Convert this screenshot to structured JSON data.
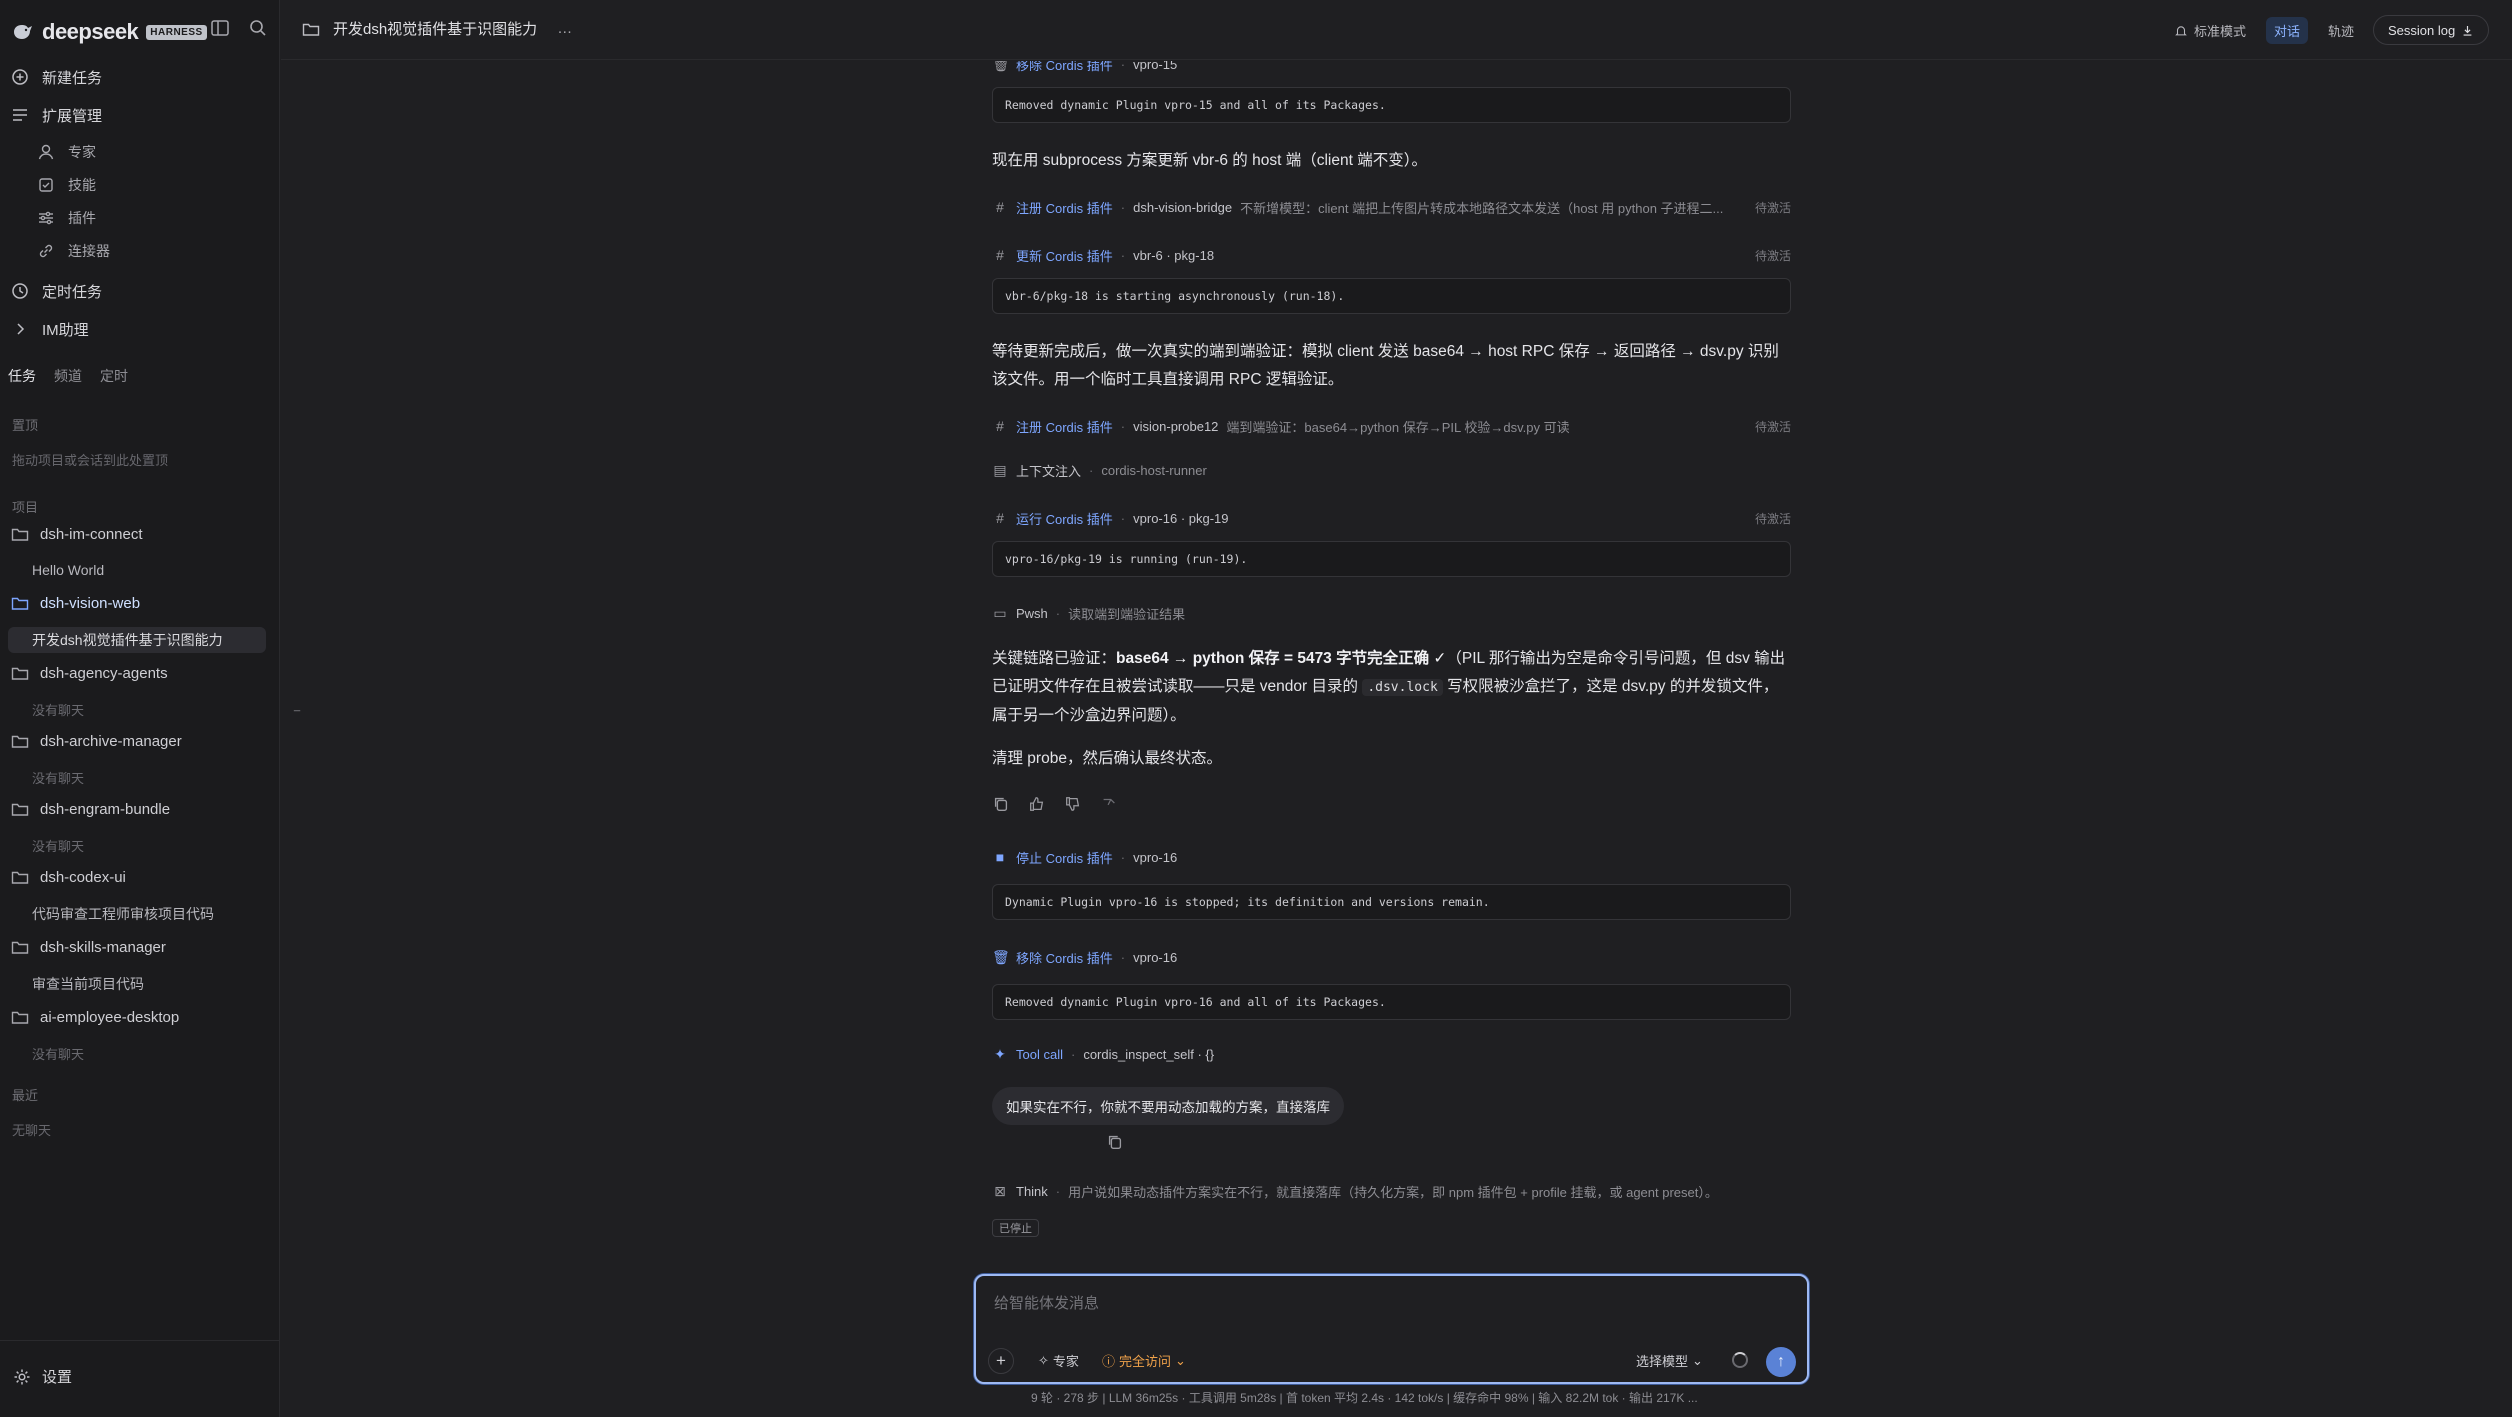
{
  "app": {
    "name": "deepseek",
    "badge": "HARNESS"
  },
  "sidebar": {
    "new_task": "新建任务",
    "extensions": "扩展管理",
    "ext_items": [
      "专家",
      "技能",
      "插件",
      "连接器"
    ],
    "scheduled": "定时任务",
    "im": "IM助理",
    "tabs": [
      "任务",
      "频道",
      "定时"
    ],
    "pinned_label": "置顶",
    "pinned_hint": "拖动项目或会话到此处置顶",
    "projects_label": "项目",
    "projects": [
      {
        "name": "dsh-im-connect",
        "chat": "Hello World"
      },
      {
        "name": "dsh-vision-web",
        "chat": "开发dsh视觉插件基于识图能力"
      },
      {
        "name": "dsh-agency-agents",
        "chat": "没有聊天"
      },
      {
        "name": "dsh-archive-manager",
        "chat": "没有聊天"
      },
      {
        "name": "dsh-engram-bundle",
        "chat": "没有聊天"
      },
      {
        "name": "dsh-codex-ui",
        "chat": "代码审查工程师审核项目代码"
      },
      {
        "name": "dsh-skills-manager",
        "chat": "审查当前项目代码"
      },
      {
        "name": "ai-employee-desktop",
        "chat": "没有聊天"
      }
    ],
    "recent_label": "最近",
    "recent_empty": "无聊天",
    "settings": "设置"
  },
  "topbar": {
    "title": "开发dsh视觉插件基于识图能力",
    "more": "…",
    "mode_standard": "标准模式",
    "mode_chat": "对话",
    "mode_trace": "轨迹",
    "session_log": "Session log"
  },
  "messages": {
    "top_partial": {
      "name": "移除 Cordis 插件",
      "arg": "vpro-15"
    },
    "code1": "Removed dynamic Plugin vpro-15 and all of its Packages.",
    "para1": "现在用 subprocess 方案更新 vbr-6 的 host 端（client 端不变）。",
    "tool1": {
      "name": "注册 Cordis 插件",
      "arg": "dsh-vision-bridge",
      "desc": "不新增模型：client 端把上传图片转成本地路径文本发送（host 用 python 子进程二...",
      "status": "待激活"
    },
    "tool2": {
      "name": "更新 Cordis 插件",
      "arg": "vbr-6 · pkg-18",
      "status": "待激活"
    },
    "code2": "vbr-6/pkg-18 is starting asynchronously (run-18).",
    "para2": "等待更新完成后，做一次真实的端到端验证：模拟 client 发送 base64 → host RPC 保存 → 返回路径 → dsv.py 识别该文件。用一个临时工具直接调用 RPC 逻辑验证。",
    "tool3": {
      "name": "注册 Cordis 插件",
      "arg": "vision-probe12",
      "desc": "端到端验证：base64→python 保存→PIL 校验→dsv.py 可读",
      "status": "待激活"
    },
    "ctx": {
      "name": "上下文注入",
      "arg": "cordis-host-runner"
    },
    "tool4": {
      "name": "运行 Cordis 插件",
      "arg": "vpro-16 · pkg-19",
      "status": "待激活"
    },
    "code3": "vpro-16/pkg-19 is running (run-19).",
    "pwsh": {
      "name": "Pwsh",
      "arg": "读取端到端验证结果"
    },
    "para3_a": "关键链路已验证：",
    "para3_b": "base64 → python 保存 = 5473 字节完全正确 ✓",
    "para3_c": "（PIL 那行输出为空是命令引号问题，但 dsv 输出已证明文件存在且被尝试读取——只是 vendor 目录的 ",
    "para3_code": ".dsv.lock",
    "para3_d": " 写权限被沙盒拦了，这是 dsv.py 的并发锁文件，属于另一个沙盒边界问题）。",
    "para4": "清理 probe，然后确认最终状态。",
    "tool5": {
      "name": "停止 Cordis 插件",
      "arg": "vpro-16"
    },
    "code4": "Dynamic Plugin vpro-16 is stopped; its definition and versions remain.",
    "tool6": {
      "name": "移除 Cordis 插件",
      "arg": "vpro-16"
    },
    "code5": "Removed dynamic Plugin vpro-16 and all of its Packages.",
    "tool7": {
      "name": "Tool call",
      "arg": "cordis_inspect_self · {}"
    },
    "user_msg": "如果实在不行，你就不要用动态加载的方案，直接落库",
    "think": {
      "name": "Think",
      "desc": "用户说如果动态插件方案实在不行，就直接落库（持久化方案，即 npm 插件包 + profile 挂载，或 agent preset）。"
    },
    "stopped": "已停止"
  },
  "input": {
    "placeholder": "给智能体发消息",
    "expert": "专家",
    "access": "完全访问",
    "model": "选择模型"
  },
  "stats": "9 轮 · 278 步  |  LLM 36m25s · 工具调用 5m28s  |  首 token 平均 2.4s · 142 tok/s  |  缓存命中 98%  |  输入 82.2M tok · 输出 217K ...",
  "colors": {
    "accent": "#7ea6ff",
    "warning": "#f0a24a",
    "focus": "#9eb9f3"
  }
}
